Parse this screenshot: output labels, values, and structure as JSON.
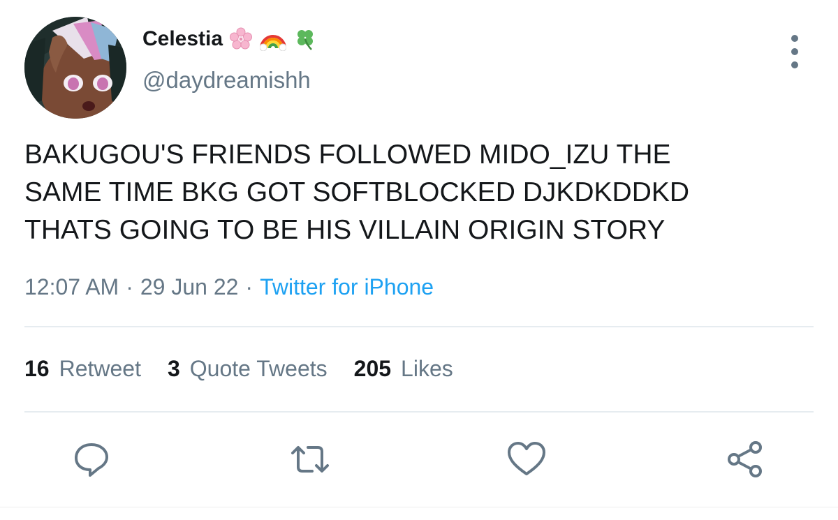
{
  "user": {
    "display_name": "Celestia",
    "name_emojis": [
      "cherry-blossom-emoji",
      "rainbow-emoji",
      "four-leaf-clover-emoji"
    ],
    "handle": "@daydreamishh"
  },
  "tweet": {
    "text": "BAKUGOU'S FRIENDS FOLLOWED MIDO_IZU THE\nSAME TIME BKG GOT SOFTBLOCKED DJKDKDDKD\nTHATS GOING TO BE HIS VILLAIN ORIGIN STORY"
  },
  "meta": {
    "time": "12:07 AM",
    "separator": "·",
    "date": "29 Jun 22",
    "source": "Twitter for iPhone"
  },
  "stats": {
    "retweets": {
      "count": "16",
      "label": "Retweet"
    },
    "quotes": {
      "count": "3",
      "label": "Quote Tweets"
    },
    "likes": {
      "count": "205",
      "label": "Likes"
    }
  },
  "actions": [
    "reply-icon",
    "retweet-icon",
    "like-icon",
    "share-icon"
  ],
  "colors": {
    "text_primary": "#14171a",
    "text_secondary": "#657786",
    "link": "#1da1f2",
    "divider": "#e6ecf0"
  }
}
